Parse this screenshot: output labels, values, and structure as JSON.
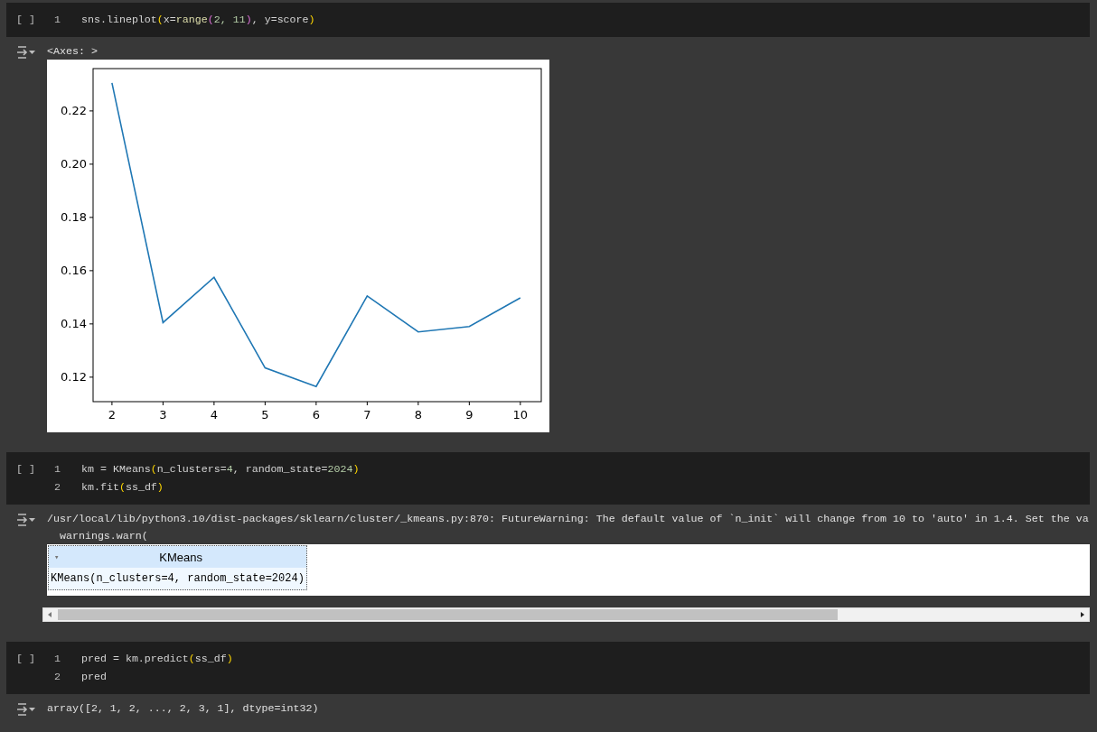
{
  "cells": [
    {
      "gutter": "[ ]",
      "lines": [
        {
          "number": "1",
          "tokens": [
            {
              "text": "sns.lineplot",
              "kind": "plain"
            },
            {
              "text": "(",
              "kind": "bracket"
            },
            {
              "text": "x=",
              "kind": "plain"
            },
            {
              "text": "range",
              "kind": "func"
            },
            {
              "text": "(",
              "kind": "bracket2"
            },
            {
              "text": "2, 11",
              "kind": "number"
            },
            {
              "text": ")",
              "kind": "bracket2"
            },
            {
              "text": ", y=score",
              "kind": "plain"
            },
            {
              "text": ")",
              "kind": "bracket"
            }
          ]
        }
      ],
      "output": [
        {
          "kind": "text",
          "text": "<Axes: >"
        },
        {
          "kind": "chart",
          "chart_data": {
            "type": "line",
            "x": [
              2,
              3,
              4,
              5,
              6,
              7,
              8,
              9,
              10
            ],
            "series": [
              {
                "color": "#1f77b4",
                "values": [
                  0.2305,
                  0.1405,
                  0.1575,
                  0.1235,
                  0.1165,
                  0.1505,
                  0.137,
                  0.139,
                  0.1498
                ]
              }
            ],
            "xlim": [
              1.63,
              10.41
            ],
            "ylim": [
              0.1108,
              0.2359
            ],
            "xticks": [
              2,
              3,
              4,
              5,
              6,
              7,
              8,
              9,
              10
            ],
            "yticks": [
              {
                "value": 0.12,
                "label": "0.12"
              },
              {
                "value": 0.14,
                "label": "0.14"
              },
              {
                "value": 0.16,
                "label": "0.16"
              },
              {
                "value": 0.18,
                "label": "0.18"
              },
              {
                "value": 0.2,
                "label": "0.20"
              },
              {
                "value": 0.22,
                "label": "0.22"
              }
            ]
          }
        }
      ]
    },
    {
      "gutter": "[ ]",
      "lines": [
        {
          "number": "1",
          "tokens": [
            {
              "text": "km = KMeans",
              "kind": "plain"
            },
            {
              "text": "(",
              "kind": "bracket"
            },
            {
              "text": "n_clusters=",
              "kind": "plain"
            },
            {
              "text": "4",
              "kind": "number"
            },
            {
              "text": ", random_state=",
              "kind": "plain"
            },
            {
              "text": "2024",
              "kind": "number"
            },
            {
              "text": ")",
              "kind": "bracket"
            }
          ]
        },
        {
          "number": "2",
          "tokens": [
            {
              "text": "km.fit",
              "kind": "plain"
            },
            {
              "text": "(",
              "kind": "bracket"
            },
            {
              "text": "ss_df",
              "kind": "plain"
            },
            {
              "text": ")",
              "kind": "bracket"
            }
          ]
        }
      ],
      "output": [
        {
          "kind": "text",
          "text": "/usr/local/lib/python3.10/dist-packages/sklearn/cluster/_kmeans.py:870: FutureWarning: The default value of `n_init` will change from 10 to 'auto' in 1.4. Set the va"
        },
        {
          "kind": "text",
          "text": "  warnings.warn("
        },
        {
          "kind": "estimator",
          "caret": "▾",
          "title": "KMeans",
          "repr": "KMeans(n_clusters=4, random_state=2024)"
        },
        {
          "kind": "scrollbar"
        }
      ]
    },
    {
      "gutter": "[ ]",
      "lines": [
        {
          "number": "1",
          "tokens": [
            {
              "text": "pred = km.predict",
              "kind": "plain"
            },
            {
              "text": "(",
              "kind": "bracket"
            },
            {
              "text": "ss_df",
              "kind": "plain"
            },
            {
              "text": ")",
              "kind": "bracket"
            }
          ]
        },
        {
          "number": "2",
          "tokens": [
            {
              "text": "pred",
              "kind": "plain"
            }
          ]
        }
      ],
      "output": [
        {
          "kind": "text",
          "text": "array([2, 1, 2, ..., 2, 3, 1], dtype=int32)"
        }
      ]
    }
  ]
}
